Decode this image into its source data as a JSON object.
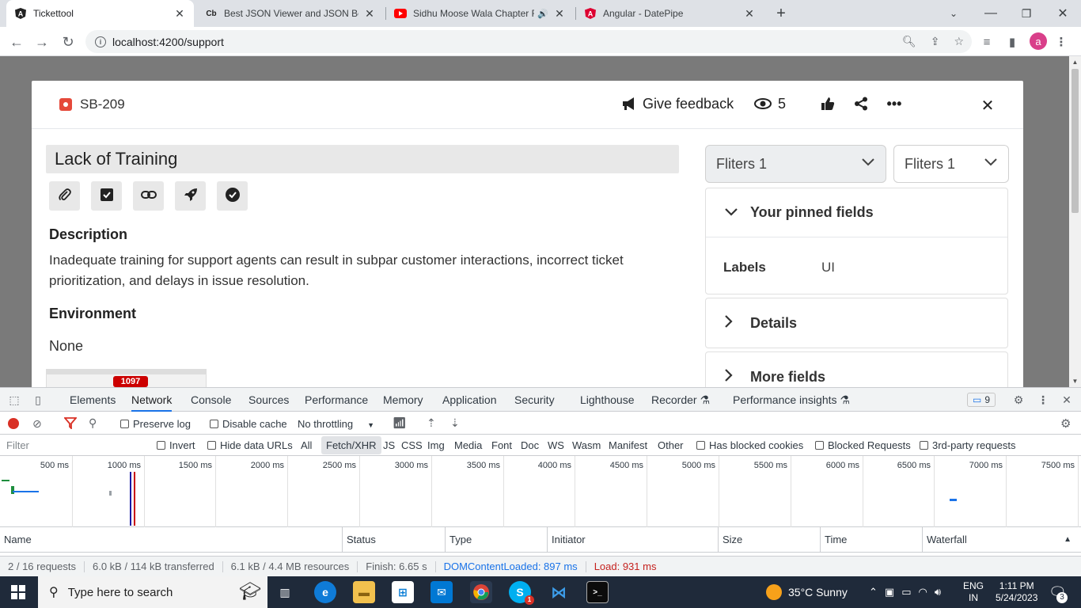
{
  "browser": {
    "tabs": [
      {
        "title": "Tickettool",
        "favicon": "angular-icon",
        "active": true
      },
      {
        "title": "Best JSON Viewer and JSON Beau",
        "favicon": "cb-icon",
        "active": false
      },
      {
        "title": "Sidhu Moose Wala Chapter F",
        "favicon": "youtube-icon",
        "active": false
      },
      {
        "title": "Angular - DatePipe",
        "favicon": "angular-icon",
        "active": false
      }
    ],
    "cb_favicon_text": "Cb",
    "url": "localhost:4200/support",
    "avatar_letter": "a"
  },
  "issue": {
    "key": "SB-209",
    "feedback_label": "Give feedback",
    "watchers_count": "5",
    "title": "Lack of Training",
    "description_heading": "Description",
    "description": "Inadequate training for support agents can result in subpar customer interactions, incorrect ticket prioritization, and delays in issue resolution.",
    "environment_heading": "Environment",
    "environment_value": "None",
    "thumbnail_text": "1097"
  },
  "sidebar": {
    "filter1": "Fliters 1",
    "filter2": "Fliters 1",
    "pinned_heading": "Your pinned fields",
    "labels_key": "Labels",
    "labels_value": "UI",
    "details_heading": "Details",
    "more_fields_heading": "More fields"
  },
  "devtools": {
    "tabs": [
      "Elements",
      "Network",
      "Console",
      "Sources",
      "Performance",
      "Memory",
      "Application",
      "Security",
      "Lighthouse",
      "Recorder",
      "Performance insights"
    ],
    "active_tab": "Network",
    "issues_count": "9",
    "preserve_log": "Preserve log",
    "disable_cache": "Disable cache",
    "throttling": "No throttling",
    "filter_placeholder": "Filter",
    "invert": "Invert",
    "hide_data_urls": "Hide data URLs",
    "type_filters": [
      "All",
      "Fetch/XHR",
      "JS",
      "CSS",
      "Img",
      "Media",
      "Font",
      "Doc",
      "WS",
      "Wasm",
      "Manifest",
      "Other"
    ],
    "active_type_filter": "Fetch/XHR",
    "has_blocked_cookies": "Has blocked cookies",
    "blocked_requests": "Blocked Requests",
    "third_party": "3rd-party requests",
    "timeline_ticks": [
      "500 ms",
      "1000 ms",
      "1500 ms",
      "2000 ms",
      "2500 ms",
      "3000 ms",
      "3500 ms",
      "4000 ms",
      "4500 ms",
      "5000 ms",
      "5500 ms",
      "6000 ms",
      "6500 ms",
      "7000 ms",
      "7500 ms"
    ],
    "columns": [
      "Name",
      "Status",
      "Type",
      "Initiator",
      "Size",
      "Time",
      "Waterfall"
    ],
    "status": {
      "requests": "2 / 16 requests",
      "transferred": "6.0 kB / 114 kB transferred",
      "resources": "6.1 kB / 4.4 MB resources",
      "finish": "Finish: 6.65 s",
      "dom": "DOMContentLoaded: 897 ms",
      "load": "Load: 931 ms"
    },
    "dom_color": "#1a1aa6",
    "load_color": "#c80000"
  },
  "taskbar": {
    "search_placeholder": "Type here to search",
    "weather": "35°C  Sunny",
    "lang": "ENG",
    "region": "IN",
    "time": "1:11 PM",
    "date": "5/24/2023",
    "notifications": "3",
    "skype_badge": "1"
  }
}
